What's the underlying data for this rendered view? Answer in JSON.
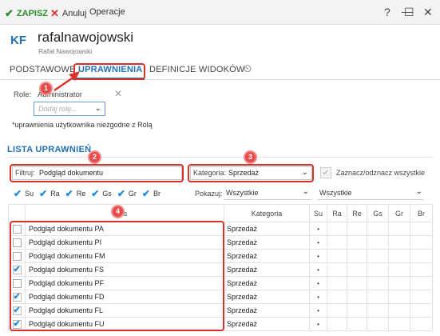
{
  "toolbar": {
    "save_label": "ZAPISZ",
    "cancel_label": "Anuluj",
    "operations_label": "Operacje"
  },
  "window_icons": {
    "help": "?",
    "minimize": "—",
    "maximize": "☐",
    "close": "✕"
  },
  "header": {
    "avatar_initials": "KF",
    "login": "rafalnawojowski",
    "full_name": "Rafał Nawojowski"
  },
  "tabs": [
    {
      "label": "PODSTAWOWE"
    },
    {
      "label": "UPRAWNIENIA"
    },
    {
      "label": "DEFINICJE WIDOKÓW"
    }
  ],
  "roles": {
    "label": "Role:",
    "assigned": "Administrator",
    "placeholder": "Dodaj rolę...",
    "note": "*uprawnienia użytkownika niezgodne z Rolą"
  },
  "permissions": {
    "section_title": "LISTA UPRAWNIEŃ",
    "filter_label": "Filtruj:",
    "filter_value": "Podgląd dokumentu",
    "category_label": "Kategoria:",
    "category_value": "Sprzedaż",
    "select_all_label": "Zaznacz/odznacz wszystkie",
    "checks": [
      "Su",
      "Ra",
      "Re",
      "Gs",
      "Gr",
      "Br"
    ],
    "show_label": "Pokazuj:",
    "show_value": "Wszystkie",
    "show_value_2": "Wszystkie",
    "columns": {
      "name": "is",
      "category": "Kategoria",
      "su": "Su",
      "ra": "Ra",
      "re": "Re",
      "gs": "Gs",
      "gr": "Gr",
      "br": "Br"
    },
    "rows": [
      {
        "name": "Podgląd dokumentu PA",
        "category": "Sprzedaż",
        "checked": false,
        "su": "•"
      },
      {
        "name": "Podgląd dokumentu PI",
        "category": "Sprzedaż",
        "checked": false,
        "su": "•"
      },
      {
        "name": "Podgląd dokumentu FM",
        "category": "Sprzedaż",
        "checked": false,
        "su": "•"
      },
      {
        "name": "Podgląd dokumentu FS",
        "category": "Sprzedaż",
        "checked": true,
        "su": "•"
      },
      {
        "name": "Podgląd dokumentu PF",
        "category": "Sprzedaż",
        "checked": false,
        "su": "•"
      },
      {
        "name": "Podgląd dokumentu FD",
        "category": "Sprzedaż",
        "checked": true,
        "su": "•"
      },
      {
        "name": "Podgląd dokumentu FL",
        "category": "Sprzedaż",
        "checked": true,
        "su": "•"
      },
      {
        "name": "Podgląd dokumentu FU",
        "category": "Sprzedaż",
        "checked": true,
        "su": "•"
      }
    ]
  },
  "badges": [
    "1",
    "2",
    "3",
    "4"
  ],
  "colors": {
    "accent": "#1f6fb5",
    "save": "#2e8b2e",
    "cancel": "#d9312b",
    "highlight": "#d9312b",
    "check": "#1f8ad6"
  }
}
